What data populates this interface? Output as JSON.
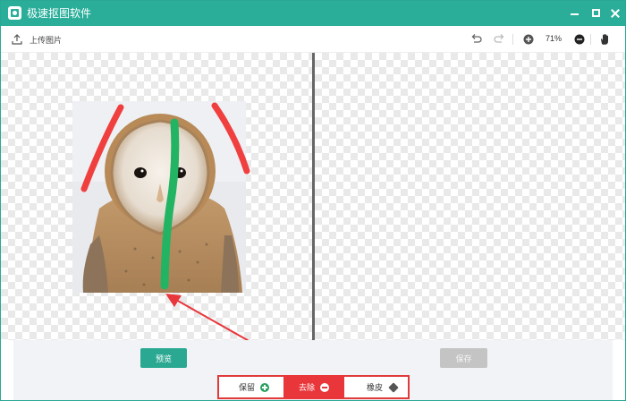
{
  "window": {
    "title": "极速抠图软件"
  },
  "toolbar": {
    "upload_label": "上传图片",
    "zoom_level": "71%"
  },
  "icons": {
    "upload": "upload-icon",
    "undo": "undo-icon",
    "redo": "redo-icon",
    "zoom_in": "plus-circle-icon",
    "zoom_out": "minus-circle-icon",
    "pan": "hand-icon"
  },
  "actions": {
    "preview_label": "预览",
    "save_label": "保存"
  },
  "brushes": {
    "keep_label": "保留",
    "remove_label": "去除",
    "eraser_label": "橡皮"
  },
  "colors": {
    "titlebar": "#2aae9a",
    "accent": "#2aa892",
    "remove_brush": "#e8363b",
    "keep_stroke": "#22b463",
    "remove_stroke": "#ef3f3f"
  }
}
